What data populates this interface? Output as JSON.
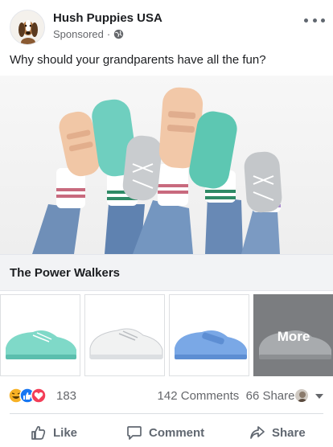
{
  "post": {
    "page_name": "Hush Puppies USA",
    "sponsored_label": "Sponsored",
    "separator": "·",
    "text": "Why should your grandparents have all the fun?",
    "avatar_icon": "basset-hound-logo",
    "privacy_icon": "globe-icon",
    "menu_icon": "more-options-icon"
  },
  "hero": {
    "description_icon": "shoes-on-feet-photo"
  },
  "product": {
    "title": "The Power Walkers"
  },
  "carousel": {
    "cards": [
      {
        "icon": "mint-sneaker-image"
      },
      {
        "icon": "white-sneaker-image"
      },
      {
        "icon": "blue-velcro-sneaker-image"
      },
      {
        "icon": "silver-sneaker-image",
        "label": "More"
      }
    ]
  },
  "engagement": {
    "reaction_count": "183",
    "comments": "142 Comments",
    "shares": "66 Shares",
    "reaction_icons": [
      "haha-icon",
      "like-icon",
      "love-icon"
    ]
  },
  "actions": {
    "like": "Like",
    "comment": "Comment",
    "share": "Share"
  },
  "colors": {
    "text_primary": "#1c1e21",
    "text_secondary": "#65676b",
    "like_blue": "#1877f2",
    "love_red": "#f33e58",
    "haha_yellow": "#f7b125",
    "more_overlay": "#7b7d80"
  }
}
